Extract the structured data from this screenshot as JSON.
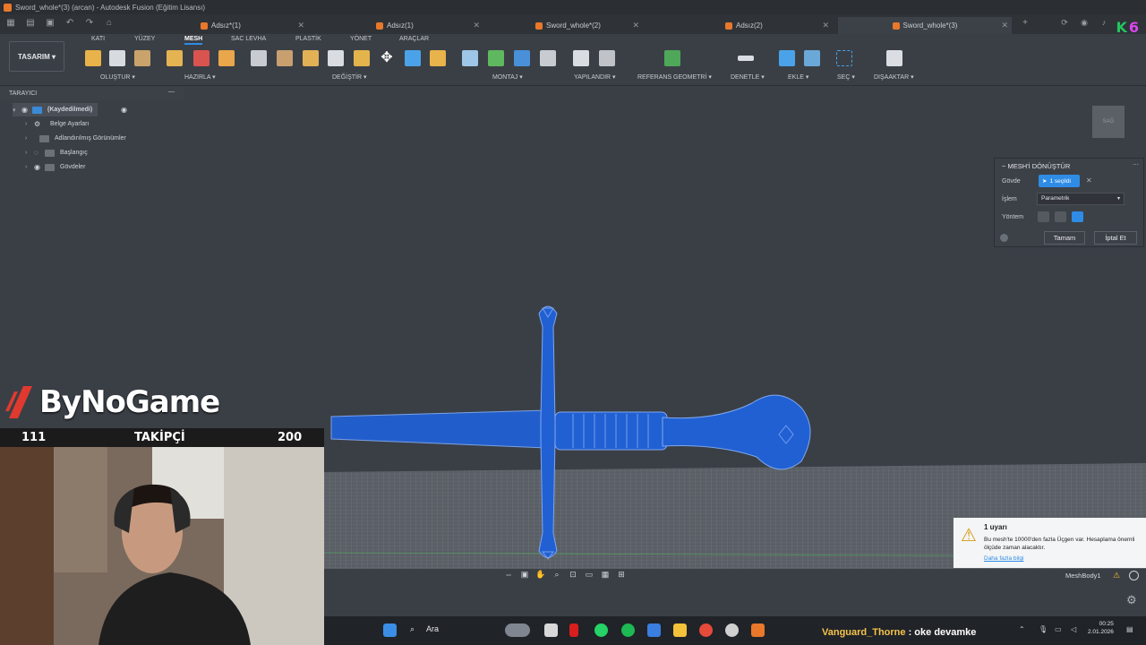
{
  "window": {
    "title": "Sword_whole*(3) (arcan) - Autodesk Fusion (Eğitim Lisansı)"
  },
  "tabs": [
    {
      "label": "Adsız*(1)",
      "active": false
    },
    {
      "label": "Adsız(1)",
      "active": false
    },
    {
      "label": "Sword_whole*(2)",
      "active": false
    },
    {
      "label": "Adsız(2)",
      "active": false
    },
    {
      "label": "Sword_whole*(3)",
      "active": true
    }
  ],
  "ribbon": {
    "workspace": "TASARIM",
    "tabs": [
      "KATI",
      "YÜZEY",
      "MESH",
      "SAC LEVHA",
      "PLASTİK",
      "YÖNET",
      "ARAÇLAR"
    ],
    "active_tab": "MESH",
    "groups": [
      "OLUŞTUR",
      "HAZIRLA",
      "DEĞİŞTİR",
      "MONTAJ",
      "YAPILANDIR",
      "REFERANS GEOMETRİ",
      "DENETLE",
      "EKLE",
      "SEÇ",
      "DIŞAAKTAR"
    ]
  },
  "browser": {
    "title": "TARAYICI",
    "root": "(Kaydedilmedi)",
    "items": [
      "Belge Ayarları",
      "Adlandırılmış Görünümler",
      "Başlangıç",
      "Gövdeler"
    ]
  },
  "mesh_panel": {
    "title": "MESH'İ DÖNÜŞTÜR",
    "body_label": "Gövde",
    "body_value": "1 seçildi",
    "operation_label": "İşlem",
    "operation_value": "Parametrik",
    "method_label": "Yöntem",
    "ok": "Tamam",
    "cancel": "İptal Et"
  },
  "viewcube": {
    "label": "SAĞ"
  },
  "warning": {
    "title": "1 uyarı",
    "body": "Bu mesh'te 10000'den fazla Üçgen var. Hesaplama önemli ölçüde zaman alacaktır.",
    "link": "Daha fazla bilgi"
  },
  "status": {
    "mesh_name": "MeshBody1"
  },
  "overlay": {
    "brand": "ByNoGame",
    "count_left": "111",
    "label": "TAKİPÇİ",
    "count_right": "200"
  },
  "taskbar": {
    "search": "Ara",
    "chat_user": "Vanguard_Thorne",
    "chat_message": " : oke devamke",
    "time": "00:25",
    "date": "2.01.2026"
  },
  "colors": {
    "accent": "#2e8ce6",
    "mesh": "#1f5fd0",
    "toast_warning": "#d79a13"
  }
}
